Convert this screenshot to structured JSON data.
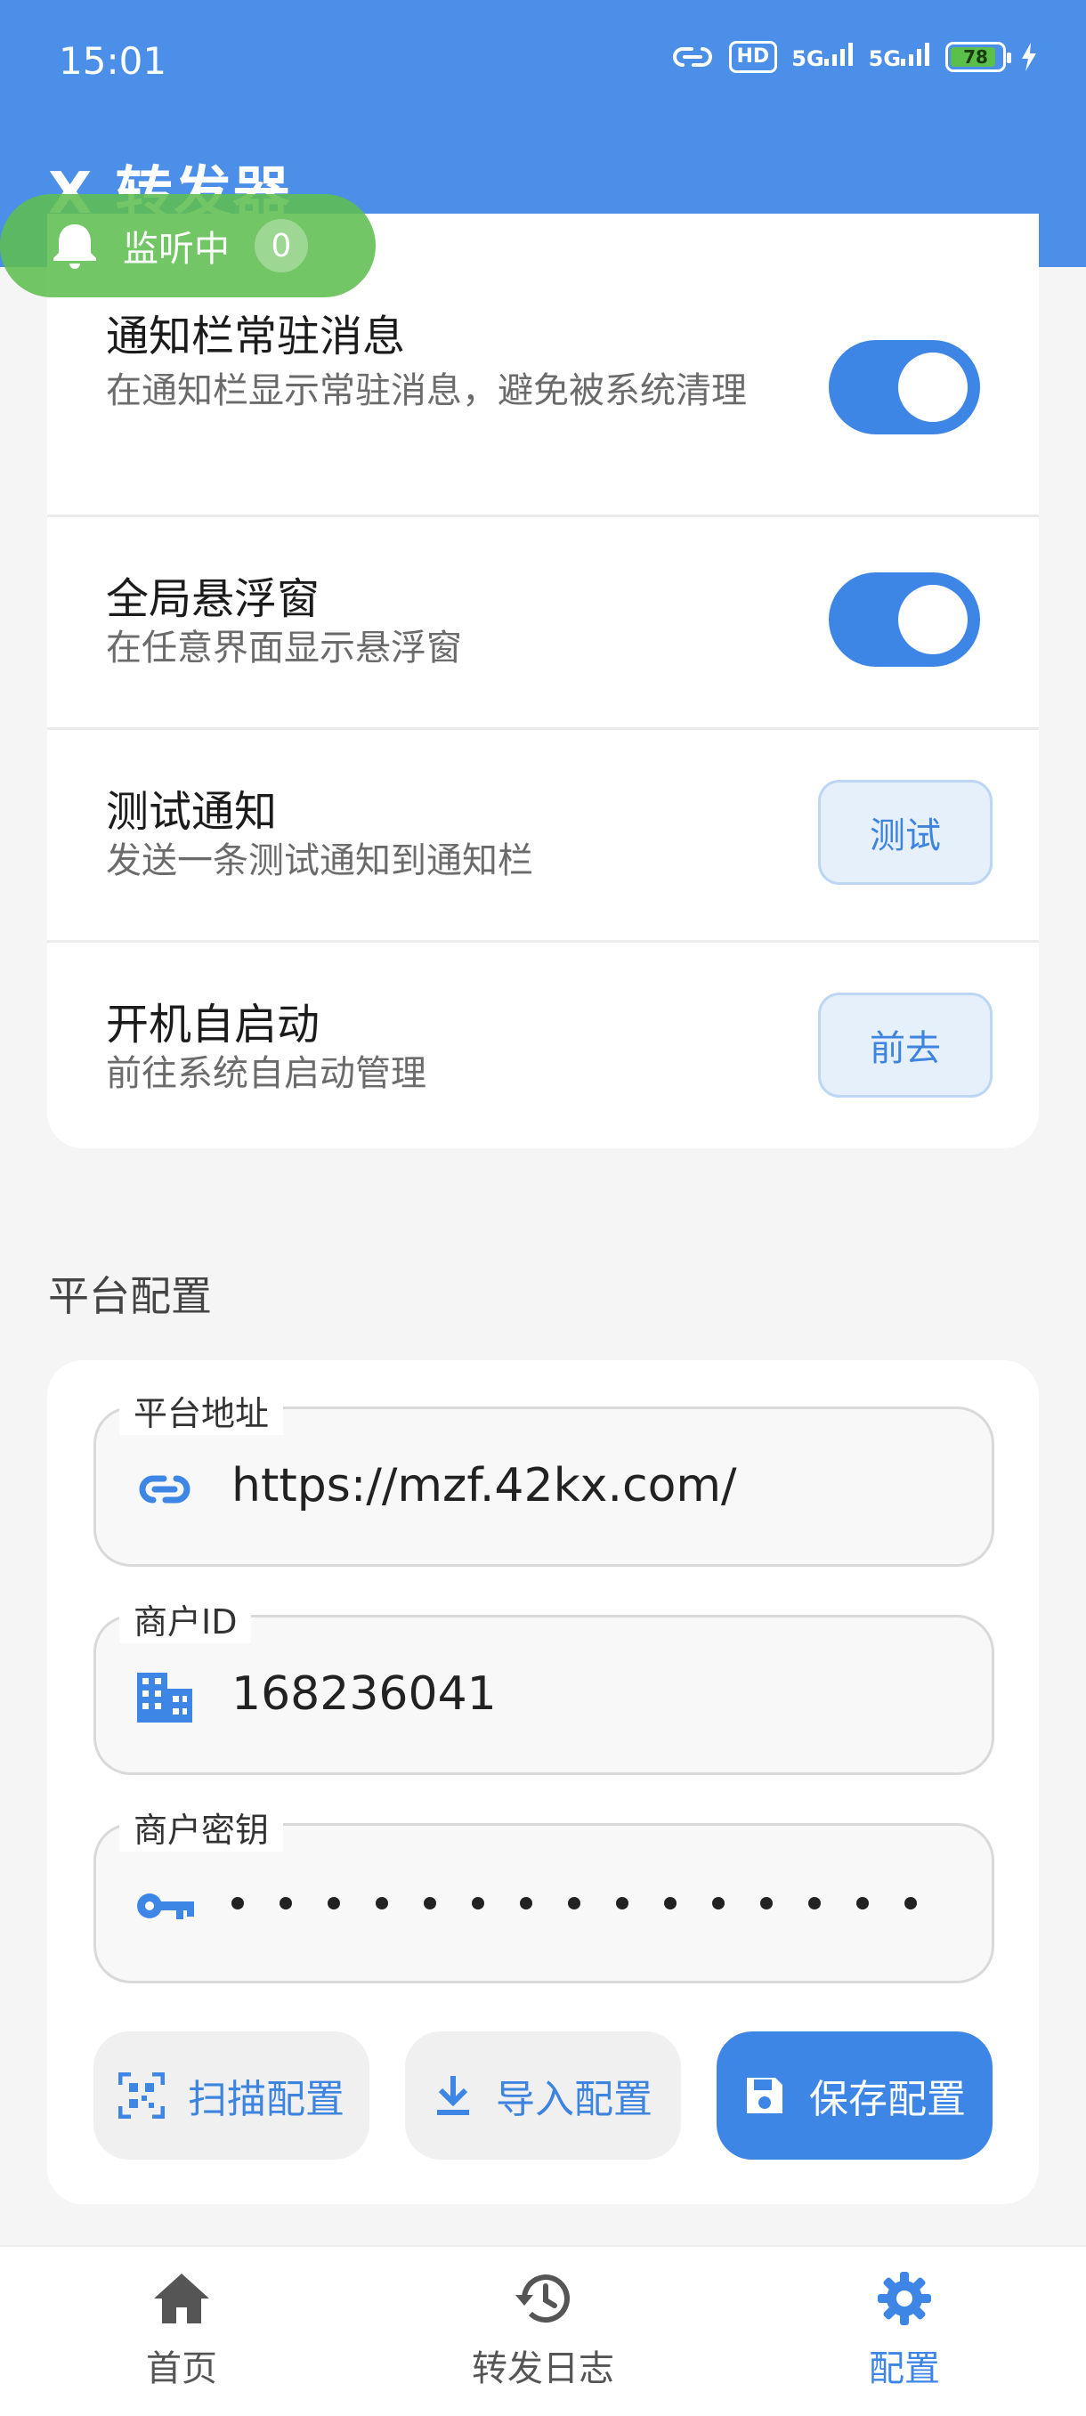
{
  "status_bar": {
    "time": "15:01",
    "hd": "HD",
    "signal1": "5G",
    "signal2": "5G",
    "battery": "78"
  },
  "appbar": {
    "title": "X 转发器"
  },
  "listening": {
    "label": "监听中",
    "count": "0"
  },
  "settings": [
    {
      "title": "通知栏常驻消息",
      "desc": "在通知栏显示常驻消息，避免被系统清理",
      "control": "toggle",
      "on": true
    },
    {
      "title": "全局悬浮窗",
      "desc": "在任意界面显示悬浮窗",
      "control": "toggle",
      "on": true
    },
    {
      "title": "测试通知",
      "desc": "发送一条测试通知到通知栏",
      "control": "button",
      "button_label": "测试"
    },
    {
      "title": "开机自启动",
      "desc": "前往系统自启动管理",
      "control": "button",
      "button_label": "前去"
    }
  ],
  "platform": {
    "section_title": "平台配置",
    "fields": {
      "url": {
        "label": "平台地址",
        "value": "https://mzf.42kx.com/",
        "icon": "link-icon"
      },
      "merchant_id": {
        "label": "商户ID",
        "value": "168236041",
        "icon": "building-icon"
      },
      "merchant_key": {
        "label": "商户密钥",
        "masked_length": 15,
        "icon": "key-icon"
      }
    },
    "actions": {
      "scan": "扫描配置",
      "import": "导入配置",
      "save": "保存配置"
    }
  },
  "bottom_nav": [
    {
      "label": "首页",
      "icon": "home-icon",
      "active": false
    },
    {
      "label": "转发日志",
      "icon": "history-icon",
      "active": false
    },
    {
      "label": "配置",
      "icon": "gear-icon",
      "active": true
    }
  ],
  "colors": {
    "primary": "#4b8fe8",
    "accent": "#3e86e6",
    "listen_pill": "#60be50"
  }
}
